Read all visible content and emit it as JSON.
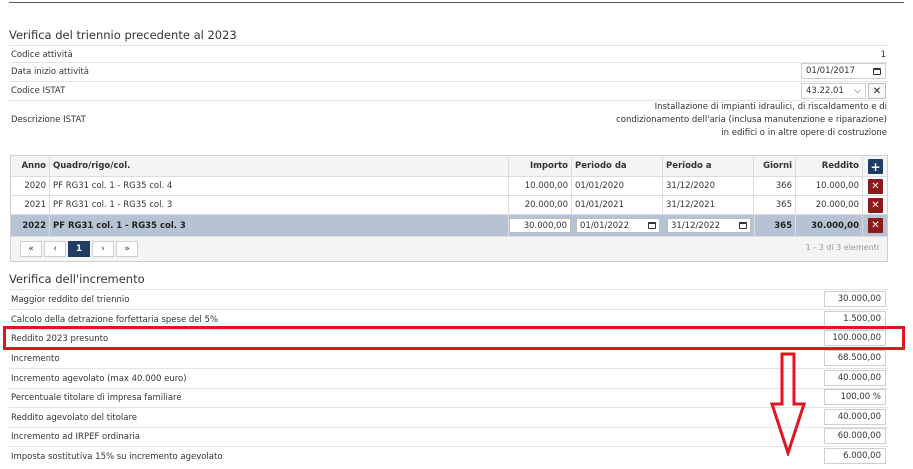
{
  "section1": {
    "title": "Verifica del triennio precedente al 2023",
    "codice_attivita_label": "Codice attività",
    "codice_attivita_value": "1",
    "data_inizio_label": "Data inizio attività",
    "data_inizio_value": "01/01/2017",
    "codice_istat_label": "Codice ISTAT",
    "codice_istat_value": "43.22.01",
    "descrizione_istat_label": "Descrizione ISTAT",
    "descrizione_istat_lines": [
      "Installazione di impianti idraulici, di riscaldamento e di",
      "condizionamento dell'aria (inclusa manutenzione e riparazione)",
      "in edifici o in altre opere di costruzione"
    ]
  },
  "table": {
    "headers": {
      "anno": "Anno",
      "quadro": "Quadro/rigo/col.",
      "importo": "Importo",
      "periodo_da": "Periodo da",
      "periodo_a": "Periodo a",
      "giorni": "Giorni",
      "reddito": "Reddito"
    },
    "rows": [
      {
        "anno": "2020",
        "quadro": "PF RG31 col. 1 - RG35 col. 4",
        "importo": "10.000,00",
        "periodo_da": "01/01/2020",
        "periodo_a": "31/12/2020",
        "giorni": "366",
        "reddito": "10.000,00"
      },
      {
        "anno": "2021",
        "quadro": "PF RG31 col. 1 - RG35 col. 3",
        "importo": "20.000,00",
        "periodo_da": "01/01/2021",
        "periodo_a": "31/12/2021",
        "giorni": "365",
        "reddito": "20.000,00"
      }
    ],
    "selected_row": {
      "anno": "2022",
      "quadro": "PF RG31 col. 1 - RG35 col. 3",
      "importo": "30.000,00",
      "periodo_da": "01/01/2022",
      "periodo_a": "31/12/2022",
      "giorni": "365",
      "reddito": "30.000,00"
    },
    "pager": {
      "first": "«",
      "prev": "‹",
      "page": "1",
      "next": "›",
      "last": "»",
      "info": "1 - 3 di 3 elementi"
    }
  },
  "section2": {
    "title": "Verifica dell'incremento",
    "rows": [
      {
        "label": "Maggior reddito del triennio",
        "value": "30.000,00"
      },
      {
        "label": "Calcolo della detrazione forfettaria spese del 5%",
        "value": "1.500,00"
      },
      {
        "label": "Reddito 2023 presunto",
        "value": "100.000,00"
      },
      {
        "label": "Incremento",
        "value": "68.500,00"
      },
      {
        "label": "Incremento agevolato (max 40.000 euro)",
        "value": "40.000,00"
      },
      {
        "label": "Percentuale titolare di impresa familiare",
        "value": "100,00 %"
      },
      {
        "label": "Reddito agevolato del titolare",
        "value": "40.000,00"
      },
      {
        "label": "Incremento ad IRPEF ordinaria",
        "value": "60.000,00"
      },
      {
        "label": "Imposta sostitutiva 15% su incremento agevolato",
        "value": "6.000,00"
      }
    ]
  },
  "icons": {
    "calendar": "calendar-icon",
    "clear": "clear-icon",
    "chevron": "chevron-down-icon",
    "add": "add-icon",
    "delete": "delete-icon",
    "arrow": "down-arrow-annotation"
  },
  "colors": {
    "selected_row": "#b5c3d4",
    "delete_button": "#8b1a1a",
    "add_button": "#1f3d63",
    "highlight_box": "#e0151f"
  }
}
